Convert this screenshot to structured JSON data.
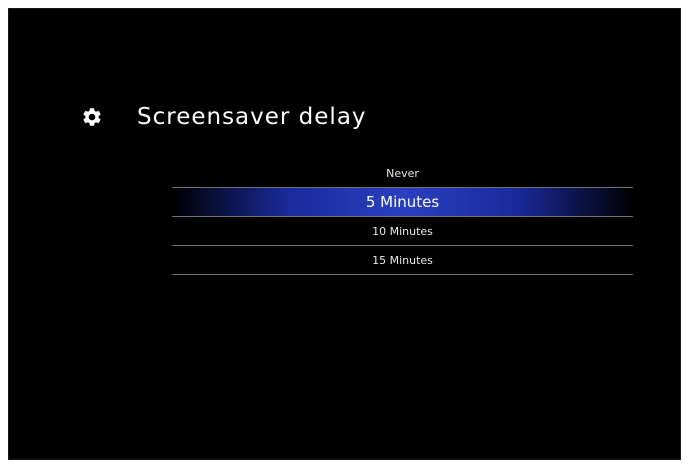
{
  "screen": {
    "title": "Screensaver delay",
    "title_icon": "gear-icon",
    "accent_color": "#2a3fc0",
    "background_color": "#000000"
  },
  "options": [
    {
      "label": "Never",
      "selected": false
    },
    {
      "label": "5 Minutes",
      "selected": true
    },
    {
      "label": "10 Minutes",
      "selected": false
    },
    {
      "label": "15 Minutes",
      "selected": false
    }
  ]
}
